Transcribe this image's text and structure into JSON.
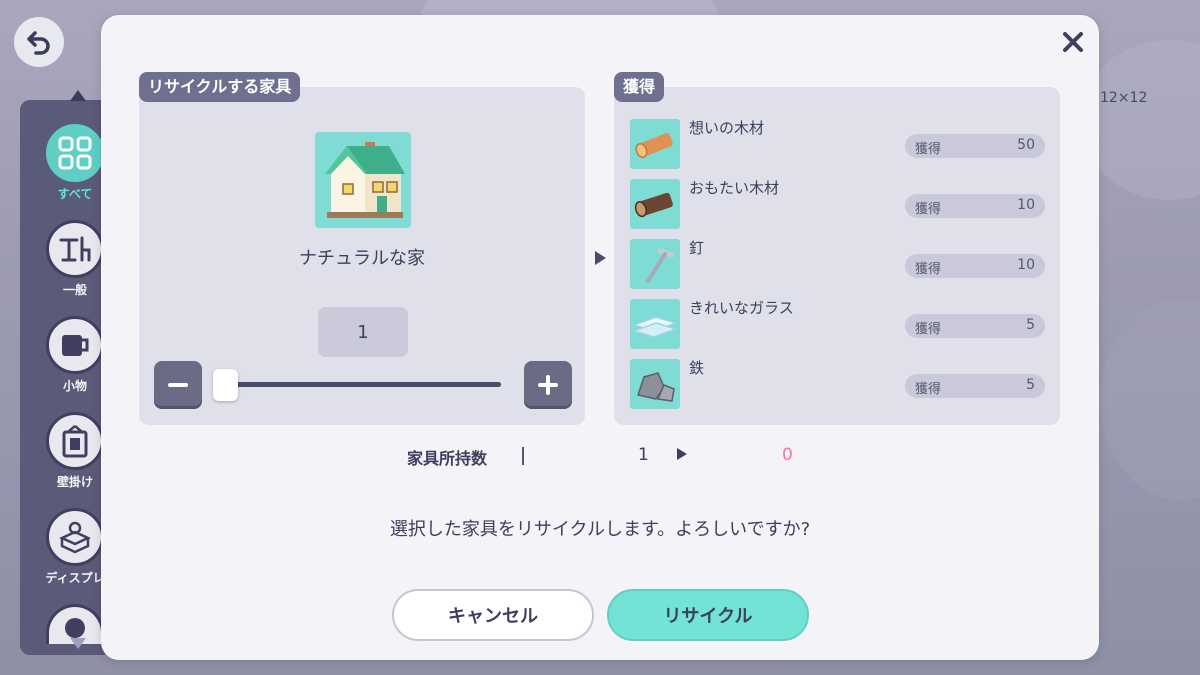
{
  "background": {
    "categories": [
      {
        "label": "すべて",
        "icon": "grid-icon",
        "active": true
      },
      {
        "label": "一般",
        "icon": "table-chair-icon",
        "active": false
      },
      {
        "label": "小物",
        "icon": "mug-icon",
        "active": false
      },
      {
        "label": "壁掛け",
        "icon": "frame-icon",
        "active": false
      },
      {
        "label": "ディスプレ",
        "icon": "display-icon",
        "active": false
      }
    ],
    "size_text": "12×12"
  },
  "modal": {
    "left_title": "リサイクルする家具",
    "right_title": "獲得",
    "item": {
      "name": "ナチュラルな家",
      "icon": "house-icon"
    },
    "quantity": "1",
    "slider": {
      "value": 1,
      "min": 1,
      "max": 1
    },
    "rewards": [
      {
        "name": "想いの木材",
        "label": "獲得",
        "value": "50",
        "icon": "log-icon"
      },
      {
        "name": "おもたい木材",
        "label": "獲得",
        "value": "10",
        "icon": "dark-log-icon"
      },
      {
        "name": "釘",
        "label": "獲得",
        "value": "10",
        "icon": "nail-icon"
      },
      {
        "name": "きれいなガラス",
        "label": "獲得",
        "value": "5",
        "icon": "glass-icon"
      },
      {
        "name": "鉄",
        "label": "獲得",
        "value": "5",
        "icon": "iron-icon"
      }
    ],
    "ownership": {
      "label": "家具所持数",
      "before": "1",
      "after": "0"
    },
    "message": "選択した家具をリサイクルします。よろしいですか?",
    "cancel_label": "キャンセル",
    "confirm_label": "リサイクル"
  },
  "colors": {
    "accent": "#73e3d6",
    "after_count": "#ff6fa8",
    "tag": "#6f7090"
  }
}
